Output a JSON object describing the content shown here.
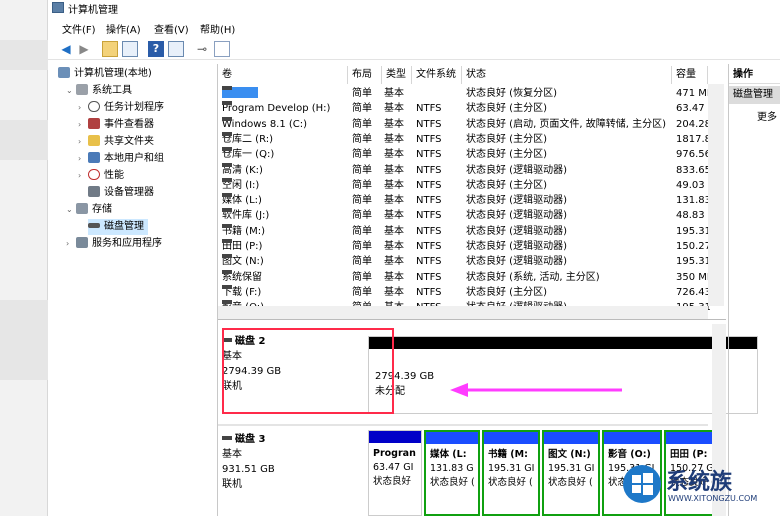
{
  "window": {
    "title": "计算机管理"
  },
  "menu": [
    "文件(F)",
    "操作(A)",
    "查看(V)",
    "帮助(H)"
  ],
  "tree": {
    "root": "计算机管理(本地)",
    "system_tools": "系统工具",
    "task_scheduler": "任务计划程序",
    "event_viewer": "事件查看器",
    "shared_folders": "共享文件夹",
    "local_users": "本地用户和组",
    "performance": "性能",
    "device_manager": "设备管理器",
    "storage": "存储",
    "disk_management": "磁盘管理",
    "services": "服务和应用程序"
  },
  "columns": {
    "volume": "卷",
    "layout": "布局",
    "type": "类型",
    "fs": "文件系统",
    "status": "状态",
    "capacity": "容量"
  },
  "volumes": [
    {
      "name": "",
      "layout": "简单",
      "type": "基本",
      "fs": "",
      "status": "状态良好 (恢复分区)",
      "capacity": "471 MI"
    },
    {
      "name": "Program Develop (H:)",
      "layout": "简单",
      "type": "基本",
      "fs": "NTFS",
      "status": "状态良好 (主分区)",
      "capacity": "63.47 C"
    },
    {
      "name": "Windows 8.1 (C:)",
      "layout": "简单",
      "type": "基本",
      "fs": "NTFS",
      "status": "状态良好 (启动, 页面文件, 故障转储, 主分区)",
      "capacity": "204.28"
    },
    {
      "name": "仓库二 (R:)",
      "layout": "简单",
      "type": "基本",
      "fs": "NTFS",
      "status": "状态良好 (主分区)",
      "capacity": "1817.8"
    },
    {
      "name": "仓库一 (Q:)",
      "layout": "简单",
      "type": "基本",
      "fs": "NTFS",
      "status": "状态良好 (主分区)",
      "capacity": "976.56"
    },
    {
      "name": "高清 (K:)",
      "layout": "简单",
      "type": "基本",
      "fs": "NTFS",
      "status": "状态良好 (逻辑驱动器)",
      "capacity": "833.65"
    },
    {
      "name": "空闲 (I:)",
      "layout": "简单",
      "type": "基本",
      "fs": "NTFS",
      "status": "状态良好 (主分区)",
      "capacity": "49.03 C"
    },
    {
      "name": "媒体 (L:)",
      "layout": "简单",
      "type": "基本",
      "fs": "NTFS",
      "status": "状态良好 (逻辑驱动器)",
      "capacity": "131.83"
    },
    {
      "name": "软件库 (J:)",
      "layout": "简单",
      "type": "基本",
      "fs": "NTFS",
      "status": "状态良好 (逻辑驱动器)",
      "capacity": "48.83 C"
    },
    {
      "name": "书籍 (M:)",
      "layout": "简单",
      "type": "基本",
      "fs": "NTFS",
      "status": "状态良好 (逻辑驱动器)",
      "capacity": "195.31"
    },
    {
      "name": "田田 (P:)",
      "layout": "简单",
      "type": "基本",
      "fs": "NTFS",
      "status": "状态良好 (逻辑驱动器)",
      "capacity": "150.27"
    },
    {
      "name": "图文 (N:)",
      "layout": "简单",
      "type": "基本",
      "fs": "NTFS",
      "status": "状态良好 (逻辑驱动器)",
      "capacity": "195.31"
    },
    {
      "name": "系统保留",
      "layout": "简单",
      "type": "基本",
      "fs": "NTFS",
      "status": "状态良好 (系统, 活动, 主分区)",
      "capacity": "350 MI"
    },
    {
      "name": "下载 (F:)",
      "layout": "简单",
      "type": "基本",
      "fs": "NTFS",
      "status": "状态良好 (主分区)",
      "capacity": "726.43"
    },
    {
      "name": "影音 (O:)",
      "layout": "简单",
      "type": "基本",
      "fs": "NTFS",
      "status": "状态良好 (逻辑驱动器)",
      "capacity": "195.31"
    }
  ],
  "disk2": {
    "name": "磁盘 2",
    "type": "基本",
    "size": "2794.39 GB",
    "state": "联机",
    "part_size": "2794.39 GB",
    "part_label": "未分配"
  },
  "disk3": {
    "name": "磁盘 3",
    "type": "基本",
    "size": "931.51 GB",
    "state": "联机",
    "parts": [
      {
        "name": "Progran",
        "size": "63.47 GI",
        "status": "状态良好"
      },
      {
        "name": "媒体 (L:",
        "size": "131.83 G",
        "status": "状态良好 ("
      },
      {
        "name": "书籍 (M:",
        "size": "195.31 GI",
        "status": "状态良好 ("
      },
      {
        "name": "图文 (N:)",
        "size": "195.31 GI",
        "status": "状态良好 ("
      },
      {
        "name": "影音 (O:)",
        "size": "195.31 GI",
        "status": "状态良好 ("
      },
      {
        "name": "田田 (P:",
        "size": "150.27 G",
        "status": "状态良好 ("
      }
    ]
  },
  "actions": {
    "header": "操作",
    "sub": "磁盘管理",
    "more": "更多"
  },
  "watermark": {
    "brand": "系统族",
    "url": "WWW.XITONGZU.COM"
  },
  "colors": {
    "primary_bar": "#0000c8",
    "logical_bar": "#1a4dff",
    "unallocated_bar": "#000000",
    "highlight": "#ff2a4a",
    "arrow": "#ff3cff",
    "selection": "#cce8ff",
    "extended_border": "#10a010"
  }
}
